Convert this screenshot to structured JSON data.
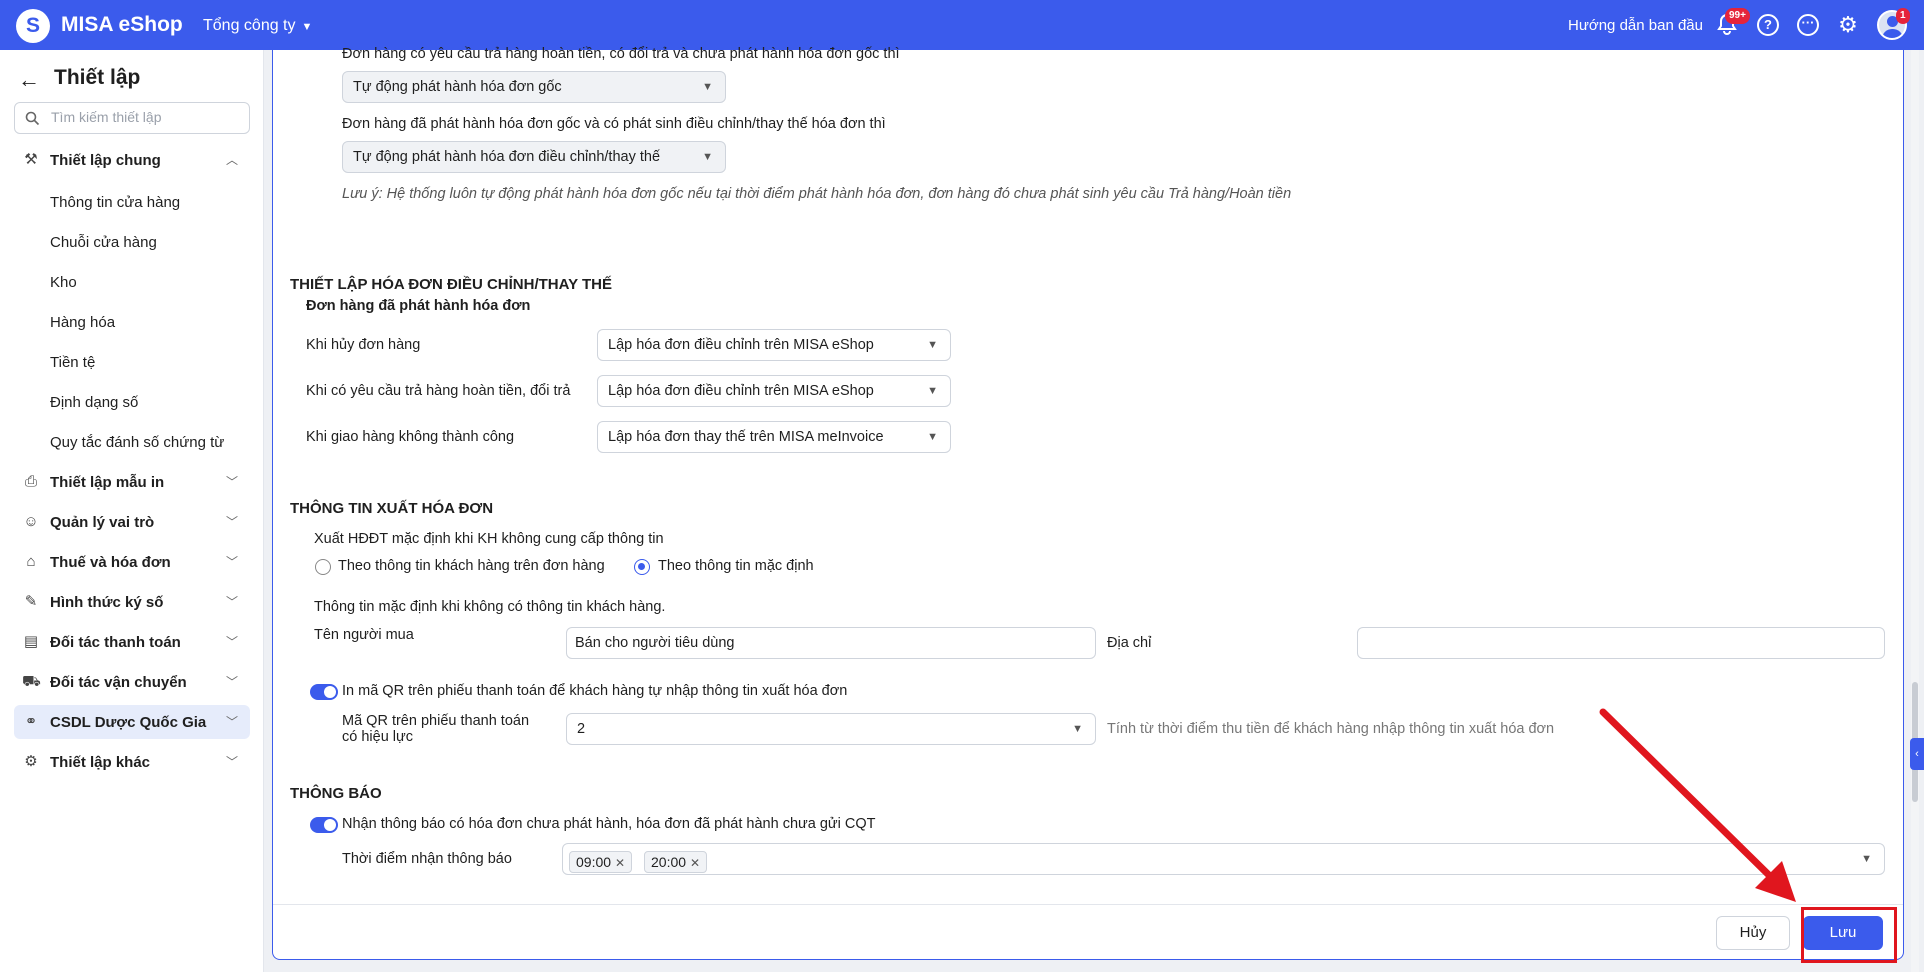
{
  "topbar": {
    "logo_letter": "S",
    "app_name": "MISA eShop",
    "company": "Tổng công ty",
    "guide": "Hướng dẫn ban đầu",
    "notifications_badge": "99+",
    "avatar_badge": "1",
    "accent_color": "#3b5bec"
  },
  "sidebar": {
    "title": "Thiết lập",
    "search_placeholder": "Tìm kiếm thiết lập",
    "general": {
      "label": "Thiết lập chung",
      "items": [
        "Thông tin cửa hàng",
        "Chuỗi cửa hàng",
        "Kho",
        "Hàng hóa",
        "Tiền tệ",
        "Định dạng số",
        "Quy tắc đánh số chứng từ"
      ]
    },
    "groups": [
      {
        "label": "Thiết lập mẫu in",
        "icon": "printer-icon"
      },
      {
        "label": "Quản lý vai trò",
        "icon": "user-role-icon"
      },
      {
        "label": "Thuế và hóa đơn",
        "icon": "bank-icon"
      },
      {
        "label": "Hình thức ký số",
        "icon": "feather-icon"
      },
      {
        "label": "Đối tác thanh toán",
        "icon": "wallet-icon"
      },
      {
        "label": "Đối tác vận chuyển",
        "icon": "truck-icon"
      },
      {
        "label": "CSDL Dược Quốc Gia",
        "icon": "link-icon"
      },
      {
        "label": "Thiết lập khác",
        "icon": "gear-icon"
      }
    ]
  },
  "main": {
    "top": {
      "q1_label": "Đơn hàng có yêu cầu trả hàng hoàn tiền, có đổi trả và chưa phát hành hóa đơn gốc thì",
      "q1_value": "Tự động phát hành hóa đơn gốc",
      "q2_label": "Đơn hàng đã phát hành hóa đơn gốc và có phát sinh điều chỉnh/thay thế hóa đơn thì",
      "q2_value": "Tự động phát hành hóa đơn điều chỉnh/thay thế",
      "note": "Lưu ý: Hệ thống luôn tự động phát hành hóa đơn gốc nếu tại thời điểm phát hành hóa đơn, đơn hàng đó chưa phát sinh yêu cầu Trả hàng/Hoàn tiền"
    },
    "adjust": {
      "title": "THIẾT LẬP HÓA ĐƠN ĐIỀU CHỈNH/THAY THẾ",
      "subtitle": "Đơn hàng đã phát hành hóa đơn",
      "rows": [
        {
          "label": "Khi hủy đơn hàng",
          "value": "Lập hóa đơn điều chỉnh trên MISA eShop"
        },
        {
          "label": "Khi có yêu cầu trả hàng hoàn tiền, đổi trả",
          "value": "Lập hóa đơn điều chỉnh trên MISA eShop"
        },
        {
          "label": "Khi giao hàng không thành công",
          "value": "Lập hóa đơn thay thế trên MISA meInvoice"
        }
      ]
    },
    "export": {
      "title": "THÔNG TIN XUẤT HÓA ĐƠN",
      "default_label": "Xuất HĐĐT mặc định khi KH không cung cấp thông tin",
      "radio1": "Theo thông tin khách hàng trên đơn hàng",
      "radio2": "Theo thông tin mặc định",
      "default_info": "Thông tin mặc định khi không có thông tin khách hàng.",
      "buyer_label": "Tên người mua",
      "buyer_value": "Bán cho người tiêu dùng",
      "address_label": "Địa chỉ",
      "address_value": "",
      "qr_toggle_label": "In mã QR trên phiếu thanh toán để khách hàng tự nhập thông tin xuất hóa đơn",
      "qr_valid_label_1": "Mã QR trên phiếu thanh toán",
      "qr_valid_label_2": "có hiệu lực",
      "qr_valid_value": "2",
      "qr_hint": "Tính từ thời điểm thu tiền để khách hàng nhập thông tin xuất hóa đơn"
    },
    "notify": {
      "title": "THÔNG BÁO",
      "toggle_label": "Nhận thông báo có hóa đơn chưa phát hành, hóa đơn đã phát hành chưa gửi CQT",
      "time_label": "Thời điểm nhận thông báo",
      "times": [
        "09:00",
        "20:00"
      ]
    },
    "footer": {
      "cancel": "Hủy",
      "save": "Lưu"
    }
  }
}
